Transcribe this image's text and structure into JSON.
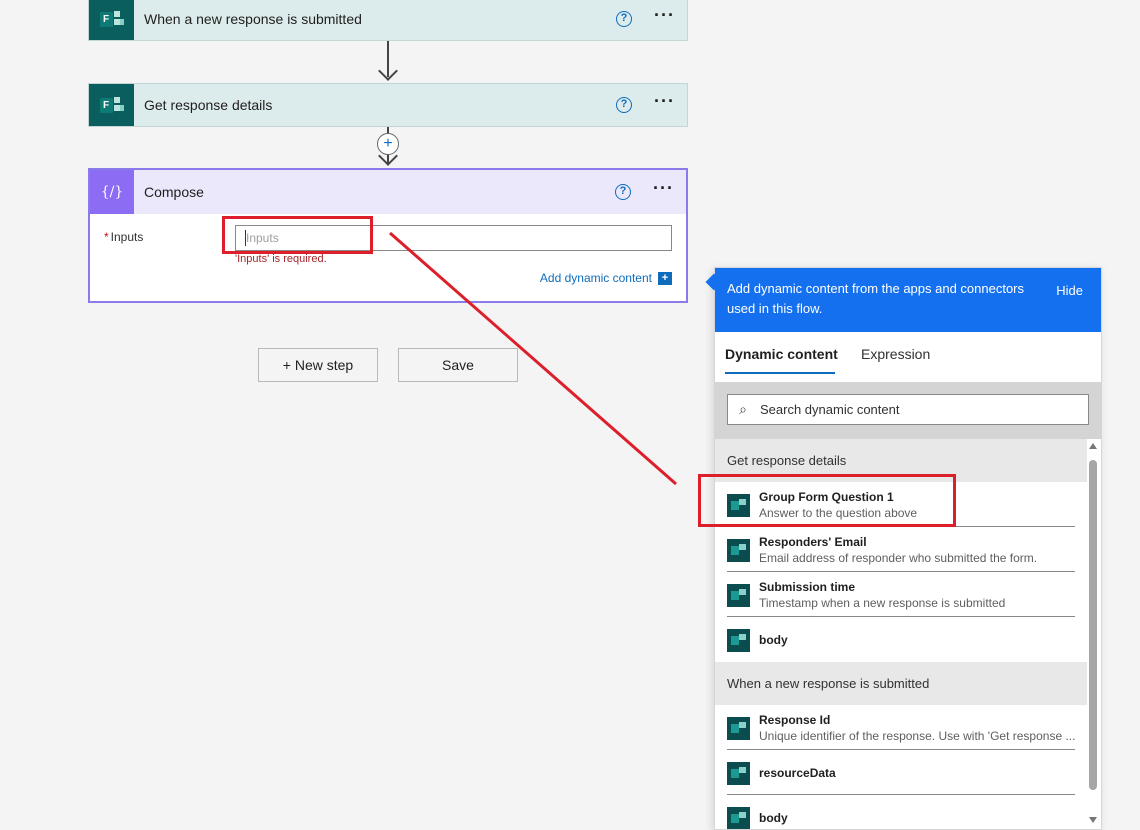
{
  "steps": [
    {
      "title": "When a new response is submitted",
      "help": "?",
      "more": "···"
    },
    {
      "title": "Get response details",
      "help": "?",
      "more": "···"
    }
  ],
  "compose": {
    "title": "Compose",
    "icon_glyph": "{∕}",
    "help": "?",
    "more": "···",
    "required_mark": "*",
    "inputs_label": "Inputs",
    "inputs_placeholder": "Inputs",
    "inputs_value": "",
    "error": "'Inputs' is required.",
    "add_dynamic": "Add dynamic content",
    "add_dynamic_plus": "+"
  },
  "connector": {
    "plus": "+"
  },
  "buttons": {
    "new_step": "+ New step",
    "save": "Save"
  },
  "panel": {
    "banner": "Add dynamic content from the apps and connectors used in this flow.",
    "hide": "Hide",
    "tabs": [
      "Dynamic content",
      "Expression"
    ],
    "search_placeholder": "Search dynamic content",
    "search_icon": "⌕",
    "groups": [
      {
        "header": "Get response details",
        "items": [
          {
            "name": "Group Form Question 1",
            "desc": "Answer to the question above"
          },
          {
            "name": "Responders' Email",
            "desc": "Email address of responder who submitted the form."
          },
          {
            "name": "Submission time",
            "desc": "Timestamp when a new response is submitted"
          },
          {
            "name": "body",
            "desc": ""
          }
        ]
      },
      {
        "header": "When a new response is submitted",
        "items": [
          {
            "name": "Response Id",
            "desc": "Unique identifier of the response. Use with 'Get response ..."
          },
          {
            "name": "resourceData",
            "desc": ""
          },
          {
            "name": "body",
            "desc": ""
          }
        ]
      }
    ]
  },
  "colors": {
    "forms_teal": "#0b5e5e",
    "compose_purple": "#8b6cf2",
    "accent_blue": "#1570ef",
    "highlight_red": "#dc1f2a"
  },
  "icons": [
    "forms-icon",
    "help-icon",
    "more-icon",
    "compose-icon",
    "search-icon",
    "plus-icon"
  ]
}
